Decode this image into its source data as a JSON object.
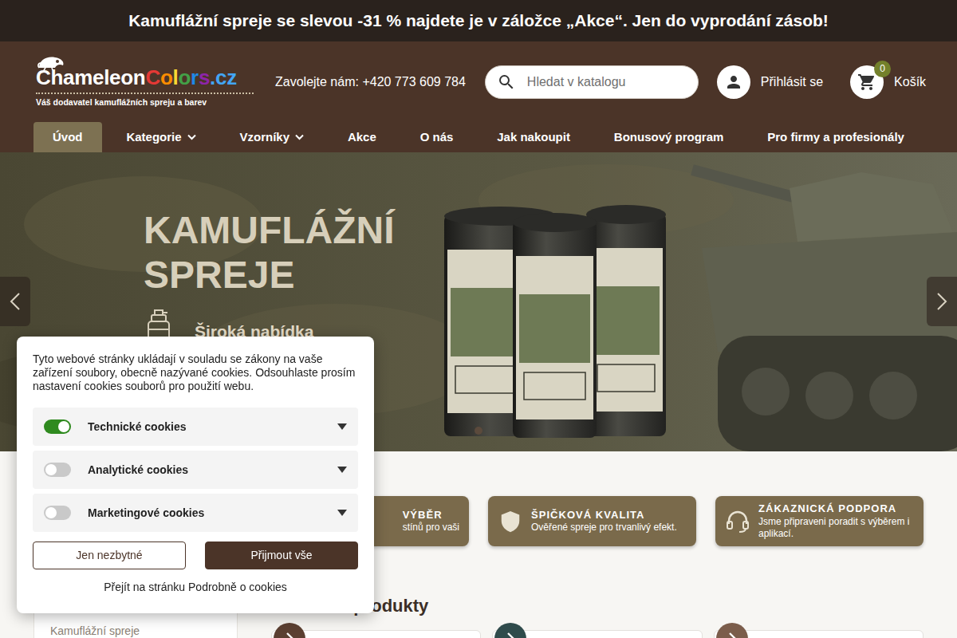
{
  "banner": {
    "text": "Kamuflážní spreje se slevou -31 % najdete je v záložce „Akce“. Jen do vyprodání zásob!"
  },
  "header": {
    "logo": {
      "parts": [
        {
          "text": "Chameleon",
          "color": "#ffffff"
        },
        {
          "text": "C",
          "color": "#e53935"
        },
        {
          "text": "o",
          "color": "#fb8c00"
        },
        {
          "text": "l",
          "color": "#fdd835"
        },
        {
          "text": "o",
          "color": "#43a047"
        },
        {
          "text": "r",
          "color": "#1e88e5"
        },
        {
          "text": "s",
          "color": "#8e24aa"
        },
        {
          "text": ".cz",
          "color": "#42a5f5"
        }
      ],
      "tagline": "Váš dodavatel kamuflážních spreju a barev"
    },
    "phone": "Zavolejte nám: +420 773 609 784",
    "search": {
      "placeholder": "Hledat v katalogu"
    },
    "login": "Přihlásit se",
    "cart": {
      "count": "0",
      "label": "Košík"
    }
  },
  "nav": [
    {
      "label": "Úvod",
      "selected": true,
      "dropdown": false
    },
    {
      "label": "Kategorie",
      "selected": false,
      "dropdown": true
    },
    {
      "label": "Vzorníky",
      "selected": false,
      "dropdown": true
    },
    {
      "label": "Akce",
      "selected": false,
      "dropdown": false
    },
    {
      "label": "O nás",
      "selected": false,
      "dropdown": false
    },
    {
      "label": "Jak nakoupit",
      "selected": false,
      "dropdown": false
    },
    {
      "label": "Bonusový program",
      "selected": false,
      "dropdown": false
    },
    {
      "label": "Pro firmy a profesionály",
      "selected": false,
      "dropdown": false
    }
  ],
  "hero": {
    "title": "KAMUFLÁŽNÍ SPREJE",
    "feature": "Široká nabídka",
    "indicators": [
      {
        "selected": true
      }
    ]
  },
  "features": [
    {
      "title": "VÝBĚR",
      "text": "stínů pro vaši"
    },
    {
      "title": "ŠPIČKOVÁ KVALITA",
      "text": "Ověřené spreje pro trvanlivý efekt."
    },
    {
      "title": "ZÁKAZNICKÁ PODPORA",
      "text": "Jsme připraveni poradit s výběrem i aplikací."
    }
  ],
  "sidebar": {
    "items": [
      "Kamuflážní spreje"
    ]
  },
  "products": {
    "title": "Oblíbené produkty",
    "items": [
      {
        "color": "#5b3f31"
      },
      {
        "color": "#2f4b4b"
      },
      {
        "color": "#7b5d4b"
      }
    ]
  },
  "cookies": {
    "text": "Tyto webové stránky ukládají v souladu se zákony na vaše zařízení soubory, obecně nazývané cookies. Odsouhlaste prosím nastavení cookies souborů pro použití webu.",
    "categories": [
      {
        "label": "Technické cookies",
        "on": true
      },
      {
        "label": "Analytické cookies",
        "on": false
      },
      {
        "label": "Marketingové cookies",
        "on": false
      }
    ],
    "buttons": [
      "Jen nezbytné",
      "Přijmout vše"
    ],
    "link": "Přejít na stránku Podrobně o cookies"
  }
}
